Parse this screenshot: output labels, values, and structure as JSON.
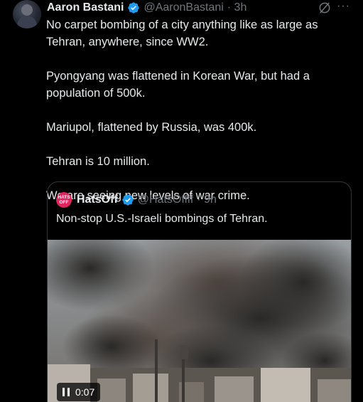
{
  "tweet": {
    "author_name": "Aaron Bastani",
    "handle": "@AaronBastani",
    "time": "· 3h",
    "verified": true,
    "icons": {
      "verified": "verified-badge-icon",
      "grok": "grok-icon",
      "more": "more-options-icon"
    },
    "more_glyph": "···",
    "paragraphs": [
      "No carpet bombing of a city anything like as large as Tehran, anywhere, since WW2.",
      "Pyongyang was flattened in Korean War, but had a population of 500k.",
      "Mariupol, flattened by Russia, was 400k.",
      "Tehran is 10 million.",
      "We are seeing new levels of war crime."
    ]
  },
  "quote": {
    "avatar_text": "HATS OFF",
    "author_name": "HatsOff",
    "handle": "@HatsOffff",
    "time": "· 9h",
    "verified": true,
    "text": "Non-stop U.S.-Israeli bombings of Tehran.",
    "video": {
      "time": "0:07",
      "state": "paused",
      "icon": "pause-icon"
    }
  },
  "colors": {
    "background": "#000000",
    "text": "#e7e9ea",
    "muted": "#71767b",
    "verified": "#1d9bf0",
    "border": "#333639",
    "avatar_brand": "#e0245e"
  }
}
